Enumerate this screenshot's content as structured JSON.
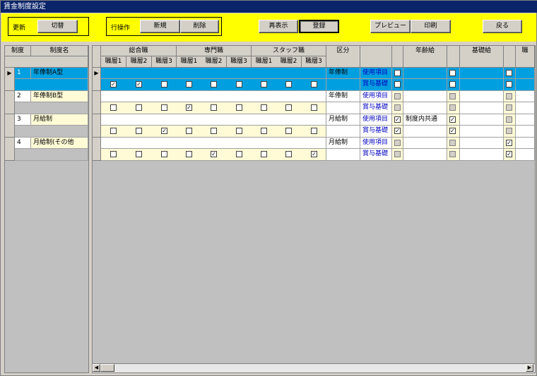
{
  "window": {
    "title": "賃金制度設定"
  },
  "toolbar": {
    "update_label": "更新",
    "switch_btn": "切替",
    "rowop_label": "行操作",
    "new_btn": "新規",
    "delete_btn": "削除",
    "refresh_btn": "再表示",
    "register_btn": "登録",
    "preview_btn": "プレビュー",
    "print_btn": "印刷",
    "back_btn": "戻る"
  },
  "left_grid": {
    "headers": [
      "制度",
      "制度名"
    ],
    "rows": [
      {
        "no": "1",
        "name": "年俸制A型"
      },
      {
        "no": "2",
        "name": "年俸制B型"
      },
      {
        "no": "3",
        "name": "月給制"
      },
      {
        "no": "4",
        "name": "月給制(その他"
      }
    ]
  },
  "right_grid": {
    "groups": [
      "総合職",
      "専門職",
      "スタッフ職",
      "区分",
      "",
      "",
      "年齢給",
      "",
      "基礎給",
      "",
      "職"
    ],
    "subheaders": [
      "職層1",
      "職層2",
      "職層3",
      "職層1",
      "職層2",
      "職層3",
      "職層1",
      "職層2",
      "職層3"
    ],
    "rows": [
      {
        "kubun": "年俸制",
        "label1": "使用項目",
        "label2": "賞与基礎",
        "extra": ""
      },
      {
        "kubun": "年俸制",
        "label1": "使用項目",
        "label2": "賞与基礎",
        "extra": ""
      },
      {
        "kubun": "月給制",
        "label1": "使用項目",
        "label2": "賞与基礎",
        "extra": "制度内共通"
      },
      {
        "kubun": "月給制",
        "label1": "使用項目",
        "label2": "賞与基礎",
        "extra": ""
      }
    ],
    "checks": [
      [
        true,
        true,
        false,
        false,
        false,
        false,
        false,
        false,
        false
      ],
      [
        false,
        false,
        false,
        true,
        false,
        false,
        false,
        false,
        false
      ],
      [
        false,
        false,
        true,
        false,
        false,
        false,
        false,
        false,
        false
      ],
      [
        false,
        false,
        false,
        false,
        true,
        false,
        false,
        false,
        true
      ]
    ]
  },
  "colors": {
    "selection": "#00a0e0",
    "cream": "#fffbd6",
    "yellow": "#ffff00",
    "title": "#0a246a"
  }
}
